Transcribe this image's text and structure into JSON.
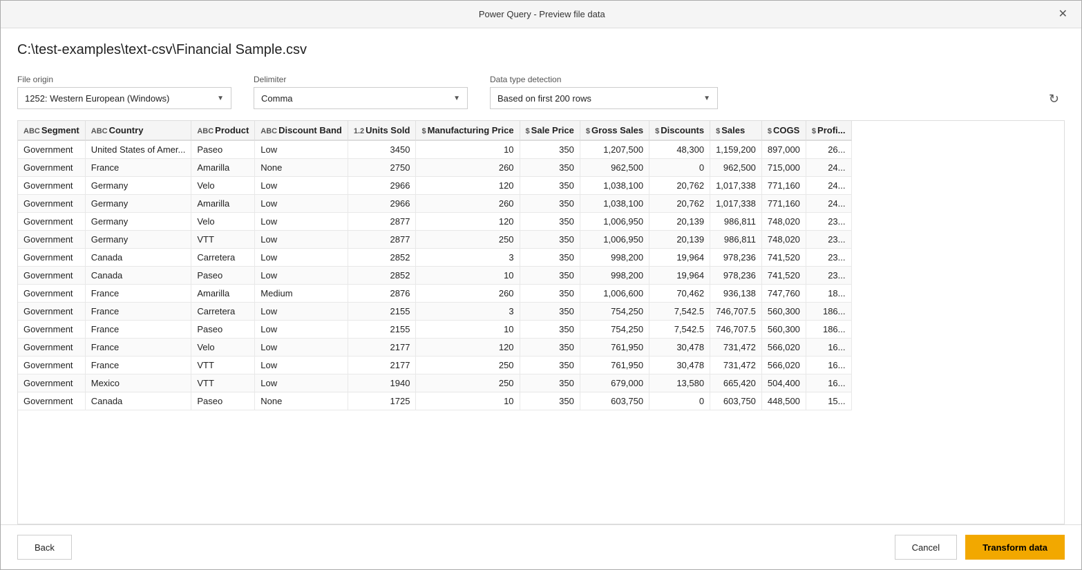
{
  "window": {
    "title": "Power Query - Preview file data",
    "close_label": "✕"
  },
  "file_path": "C:\\test-examples\\text-csv\\Financial Sample.csv",
  "controls": {
    "file_origin_label": "File origin",
    "file_origin_value": "1252: Western European (Windows)",
    "delimiter_label": "Delimiter",
    "delimiter_value": "Comma",
    "data_type_label": "Data type detection",
    "data_type_value": "Based on first 200 rows"
  },
  "table": {
    "columns": [
      {
        "id": "segment",
        "label": "Segment",
        "type": "ABC",
        "numeric": false
      },
      {
        "id": "country",
        "label": "Country",
        "type": "ABC",
        "numeric": false
      },
      {
        "id": "product",
        "label": "Product",
        "type": "ABC",
        "numeric": false
      },
      {
        "id": "discount_band",
        "label": "Discount Band",
        "type": "ABC",
        "numeric": false
      },
      {
        "id": "units_sold",
        "label": "Units Sold",
        "type": "1.2",
        "numeric": true
      },
      {
        "id": "mfg_price",
        "label": "Manufacturing Price",
        "type": "$",
        "numeric": true
      },
      {
        "id": "sale_price",
        "label": "Sale Price",
        "type": "$",
        "numeric": true
      },
      {
        "id": "gross_sales",
        "label": "Gross Sales",
        "type": "$",
        "numeric": true
      },
      {
        "id": "discounts",
        "label": "Discounts",
        "type": "$",
        "numeric": true
      },
      {
        "id": "sales",
        "label": "Sales",
        "type": "$",
        "numeric": true
      },
      {
        "id": "cogs",
        "label": "COGS",
        "type": "$",
        "numeric": true
      },
      {
        "id": "profit",
        "label": "Profi...",
        "type": "$",
        "numeric": true
      }
    ],
    "rows": [
      [
        "Government",
        "United States of Amer...",
        "Paseo",
        "Low",
        "3450",
        "10",
        "350",
        "1,207,500",
        "48,300",
        "1,159,200",
        "897,000",
        "26..."
      ],
      [
        "Government",
        "France",
        "Amarilla",
        "None",
        "2750",
        "260",
        "350",
        "962,500",
        "0",
        "962,500",
        "715,000",
        "24..."
      ],
      [
        "Government",
        "Germany",
        "Velo",
        "Low",
        "2966",
        "120",
        "350",
        "1,038,100",
        "20,762",
        "1,017,338",
        "771,160",
        "24..."
      ],
      [
        "Government",
        "Germany",
        "Amarilla",
        "Low",
        "2966",
        "260",
        "350",
        "1,038,100",
        "20,762",
        "1,017,338",
        "771,160",
        "24..."
      ],
      [
        "Government",
        "Germany",
        "Velo",
        "Low",
        "2877",
        "120",
        "350",
        "1,006,950",
        "20,139",
        "986,811",
        "748,020",
        "23..."
      ],
      [
        "Government",
        "Germany",
        "VTT",
        "Low",
        "2877",
        "250",
        "350",
        "1,006,950",
        "20,139",
        "986,811",
        "748,020",
        "23..."
      ],
      [
        "Government",
        "Canada",
        "Carretera",
        "Low",
        "2852",
        "3",
        "350",
        "998,200",
        "19,964",
        "978,236",
        "741,520",
        "23..."
      ],
      [
        "Government",
        "Canada",
        "Paseo",
        "Low",
        "2852",
        "10",
        "350",
        "998,200",
        "19,964",
        "978,236",
        "741,520",
        "23..."
      ],
      [
        "Government",
        "France",
        "Amarilla",
        "Medium",
        "2876",
        "260",
        "350",
        "1,006,600",
        "70,462",
        "936,138",
        "747,760",
        "18..."
      ],
      [
        "Government",
        "France",
        "Carretera",
        "Low",
        "2155",
        "3",
        "350",
        "754,250",
        "7,542.5",
        "746,707.5",
        "560,300",
        "186..."
      ],
      [
        "Government",
        "France",
        "Paseo",
        "Low",
        "2155",
        "10",
        "350",
        "754,250",
        "7,542.5",
        "746,707.5",
        "560,300",
        "186..."
      ],
      [
        "Government",
        "France",
        "Velo",
        "Low",
        "2177",
        "120",
        "350",
        "761,950",
        "30,478",
        "731,472",
        "566,020",
        "16..."
      ],
      [
        "Government",
        "France",
        "VTT",
        "Low",
        "2177",
        "250",
        "350",
        "761,950",
        "30,478",
        "731,472",
        "566,020",
        "16..."
      ],
      [
        "Government",
        "Mexico",
        "VTT",
        "Low",
        "1940",
        "250",
        "350",
        "679,000",
        "13,580",
        "665,420",
        "504,400",
        "16..."
      ],
      [
        "Government",
        "Canada",
        "Paseo",
        "None",
        "1725",
        "10",
        "350",
        "603,750",
        "0",
        "603,750",
        "448,500",
        "15..."
      ]
    ]
  },
  "footer": {
    "back_label": "Back",
    "cancel_label": "Cancel",
    "transform_label": "Transform data"
  }
}
